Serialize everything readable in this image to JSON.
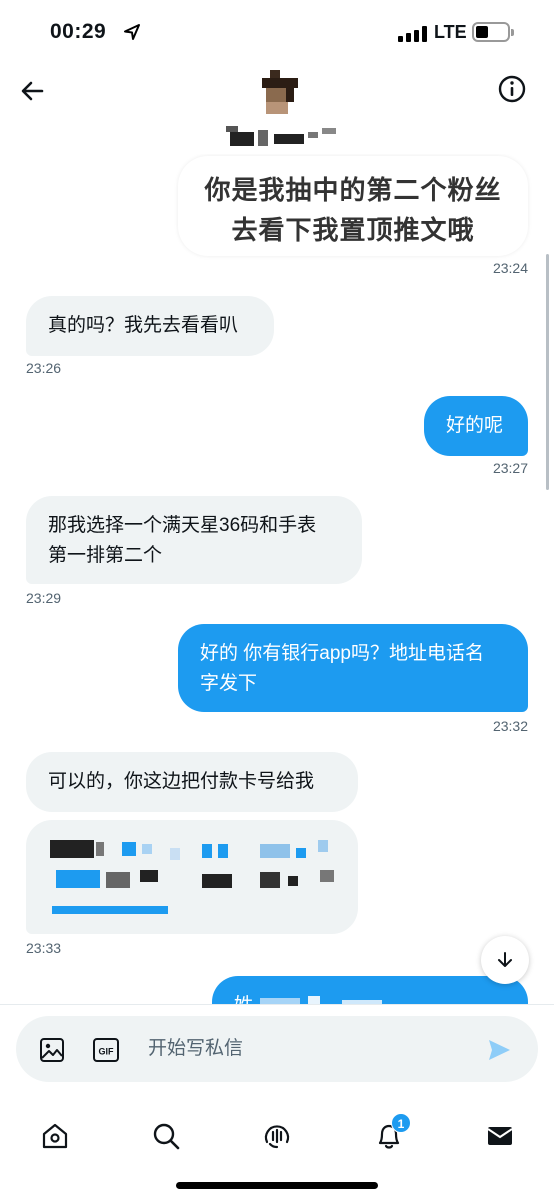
{
  "status_bar": {
    "time": "00:29",
    "network": "LTE",
    "signal_bars": 4,
    "battery_level": 0.3
  },
  "header": {
    "back_icon": "arrow-left-icon",
    "info_icon": "info-circle-icon",
    "display_name_redacted": true
  },
  "messages": [
    {
      "side": "out",
      "type": "image-text",
      "lines": [
        "你是我抽中的第二个粉丝",
        "去看下我置顶推文哦"
      ],
      "time": "23:24"
    },
    {
      "side": "in",
      "text": "真的吗？我先去看看叭",
      "time": "23:26"
    },
    {
      "side": "out",
      "text": "好的呢",
      "time": "23:27"
    },
    {
      "side": "in",
      "lines": [
        "那我选择一个满天星36码和手表",
        "第一排第二个"
      ],
      "time": "23:29"
    },
    {
      "side": "out",
      "lines": [
        "好的 你有银行app吗？地址电话名",
        "字发下"
      ],
      "time": "23:32"
    },
    {
      "side": "in",
      "text": "可以的，你这边把付款卡号给我",
      "time": ""
    },
    {
      "side": "in",
      "type": "redacted",
      "time": "23:33"
    },
    {
      "side": "out",
      "text": "姓",
      "partially_hidden": true
    }
  ],
  "composer": {
    "placeholder": "开始写私信",
    "media_icon": "image-icon",
    "gif_icon": "gif-icon",
    "send_icon": "send-icon"
  },
  "scroll_down_icon": "arrow-down-icon",
  "tabs": [
    {
      "name": "home",
      "icon": "home-icon"
    },
    {
      "name": "search",
      "icon": "search-icon"
    },
    {
      "name": "spaces",
      "icon": "spaces-icon"
    },
    {
      "name": "notifications",
      "icon": "bell-icon",
      "badge": "1"
    },
    {
      "name": "messages",
      "icon": "envelope-icon",
      "active": true
    }
  ],
  "colors": {
    "accent": "#1d9bf0",
    "incoming_bubble": "#eff3f4",
    "text": "#0f1419",
    "muted": "#536471"
  }
}
